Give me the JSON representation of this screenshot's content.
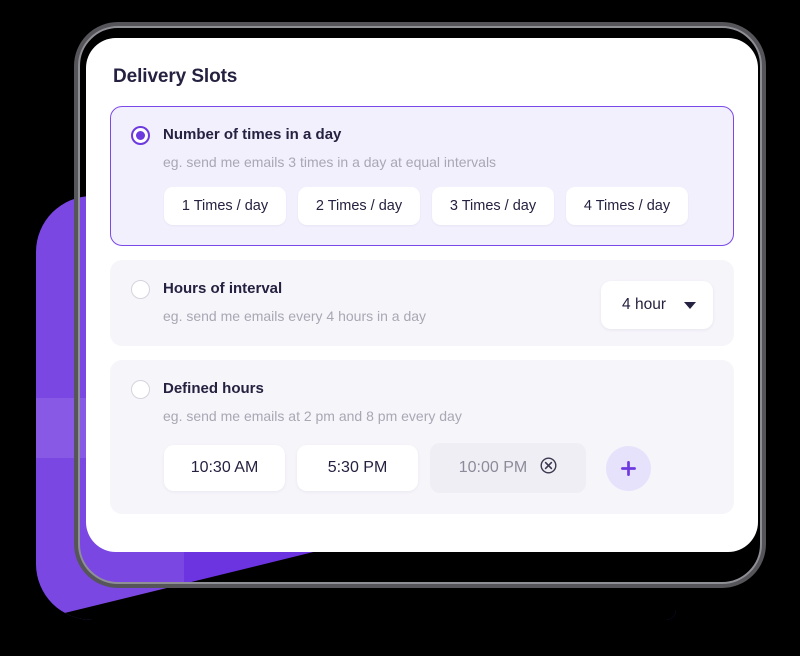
{
  "theme": {
    "accent": "#6d3ae0",
    "blob": "#6c33e0",
    "selected_panel_bg": "#f2f0fd",
    "selected_panel_border": "#7b49e8",
    "plain_panel_bg": "#f6f5fa",
    "title_color": "#252140",
    "muted_color": "#a9a7b4",
    "card_bg": "#ffffff",
    "page_bg": "#000000"
  },
  "card": {
    "title": "Delivery Slots"
  },
  "options": [
    {
      "id": "number-of-times",
      "selected": true,
      "title": "Number of times in a day",
      "description": "eg. send me emails 3 times in a day at equal intervals",
      "chips": [
        "1 Times / day",
        "2 Times / day",
        "3 Times / day",
        "4 Times / day"
      ]
    },
    {
      "id": "hours-of-interval",
      "selected": false,
      "title": "Hours of interval",
      "description": "eg. send me emails every 4 hours in a day",
      "dropdown": {
        "value": "4 hour",
        "icon": "chevron-down-icon"
      }
    },
    {
      "id": "defined-hours",
      "selected": false,
      "title": "Defined hours",
      "description": "eg. send me emails at 2 pm and 8 pm every day",
      "times": [
        {
          "label": "10:30 AM",
          "editing": false
        },
        {
          "label": "5:30 PM",
          "editing": false
        },
        {
          "label": "10:00 PM",
          "editing": true,
          "remove_icon": "circle-x-icon"
        }
      ],
      "add_button": {
        "icon": "plus-icon"
      }
    }
  ]
}
